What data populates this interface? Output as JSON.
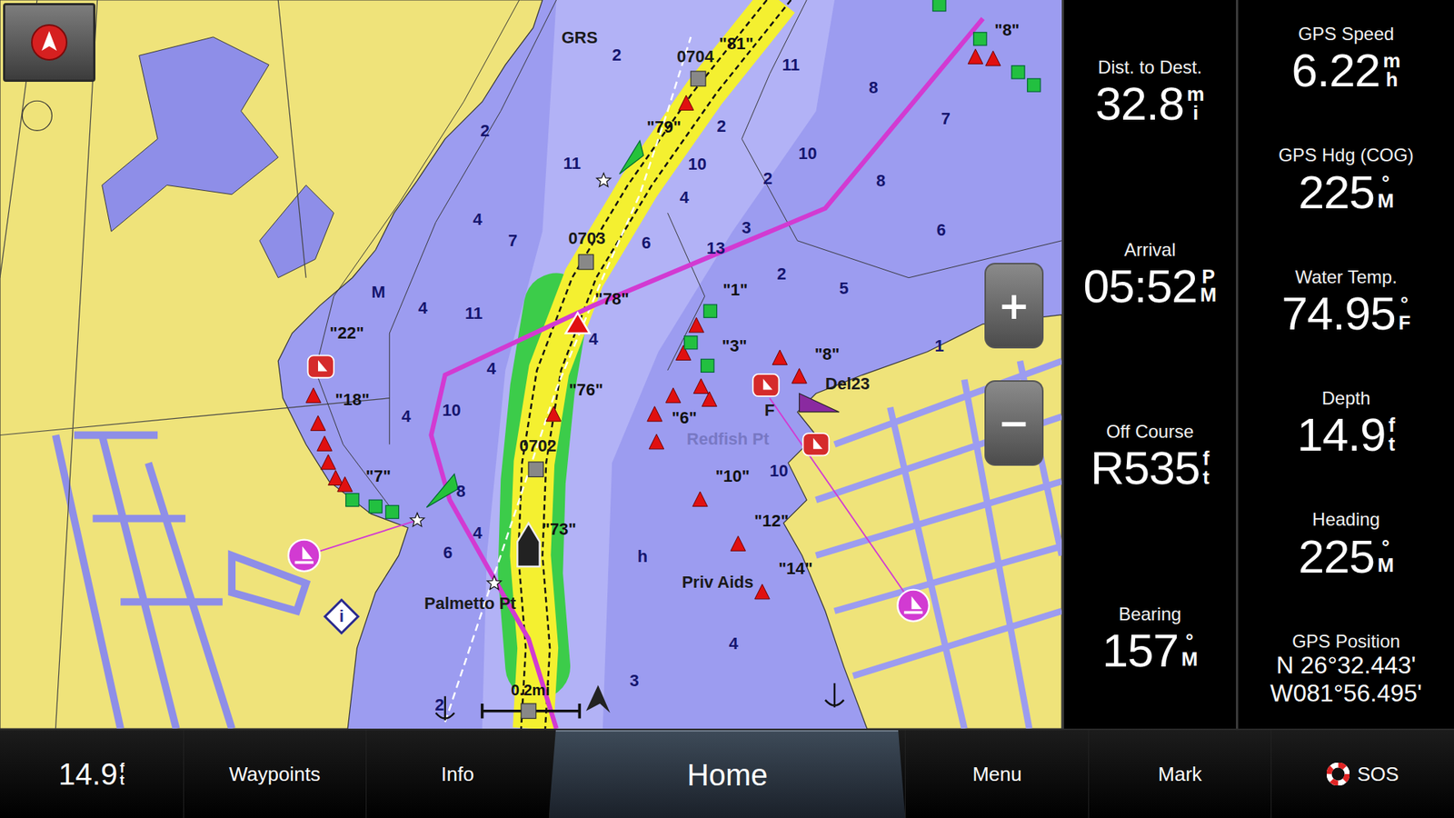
{
  "map": {
    "soundings": [
      "2",
      "11",
      "8",
      "7",
      "2",
      "2",
      "11",
      "10",
      "2",
      "10",
      "8",
      "4",
      "6",
      "4",
      "7",
      "6",
      "3",
      "13",
      "2",
      "5",
      "4",
      "11",
      "1",
      "4",
      "4",
      "4",
      "10",
      "8",
      "4",
      "6",
      "10",
      "4",
      "3",
      "2",
      "h",
      "M"
    ],
    "aid_labels": [
      "\"81\"",
      "\"79\"",
      "\"78\"",
      "\"76\"",
      "\"73\"",
      "\"22\"",
      "\"18\"",
      "\"7\"",
      "\"1\"",
      "\"3\"",
      "\"6\"",
      "\"8\"",
      "\"10\"",
      "\"12\"",
      "\"14\"",
      "\"8\""
    ],
    "place_names": [
      {
        "text": "GRS",
        "dimmed": false
      },
      {
        "text": "0704",
        "dimmed": false
      },
      {
        "text": "0703",
        "dimmed": false
      },
      {
        "text": "0702",
        "dimmed": false
      },
      {
        "text": "Palmetto Pt",
        "dimmed": false
      },
      {
        "text": "Redfish Pt",
        "dimmed": true
      },
      {
        "text": "Priv Aids",
        "dimmed": false
      },
      {
        "text": "Del23",
        "dimmed": false
      },
      {
        "text": "F",
        "dimmed": false
      }
    ],
    "scale": "0.2mi",
    "zoom_in": "+",
    "zoom_out": "−",
    "info_marker": "i"
  },
  "data_fields_left": [
    {
      "label": "Dist. to Dest.",
      "value": "32.8",
      "unit_top": "m",
      "unit_bottom": "i"
    },
    {
      "label": "Arrival",
      "value": "05:52",
      "unit_top": "P",
      "unit_bottom": "M"
    },
    {
      "label": "Off Course",
      "value": "R535",
      "unit_top": "f",
      "unit_bottom": "t"
    },
    {
      "label": "Bearing",
      "value": "157",
      "unit_top": "°",
      "unit_bottom": "M"
    }
  ],
  "data_fields_right": [
    {
      "label": "GPS Speed",
      "value": "6.22",
      "unit_top": "m",
      "unit_bottom": "h"
    },
    {
      "label": "GPS Hdg (COG)",
      "value": "225",
      "unit_top": "°",
      "unit_bottom": "M"
    },
    {
      "label": "Water Temp.",
      "value": "74.95",
      "unit_top": "°",
      "unit_bottom": "F"
    },
    {
      "label": "Depth",
      "value": "14.9",
      "unit_top": "f",
      "unit_bottom": "t"
    },
    {
      "label": "Heading",
      "value": "225",
      "unit_top": "°",
      "unit_bottom": "M"
    }
  ],
  "gps_position": {
    "label": "GPS Position",
    "lat": "N  26°32.443'",
    "lon": "W081°56.495'"
  },
  "bottom_bar": {
    "depth": {
      "value": "14.9",
      "unit_top": "f",
      "unit_bottom": "t"
    },
    "buttons": [
      {
        "label": "Waypoints",
        "selected": false
      },
      {
        "label": "Info",
        "selected": false
      },
      {
        "label": "Home",
        "selected": true
      },
      {
        "label": "Menu",
        "selected": false
      },
      {
        "label": "Mark",
        "selected": false
      },
      {
        "label": "SOS",
        "selected": false
      }
    ]
  }
}
